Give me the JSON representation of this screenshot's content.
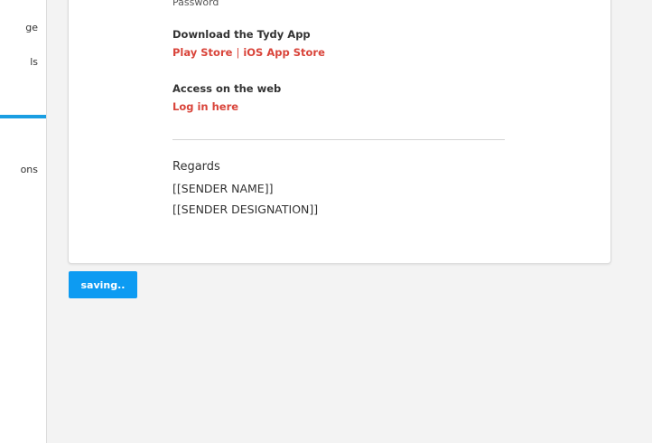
{
  "sidebar": {
    "items": [
      {
        "label": "ge"
      },
      {
        "label": "ls"
      },
      {
        "label": "ons"
      }
    ]
  },
  "email": {
    "cutoff_label": "Password",
    "download_heading": "Download the Tydy App",
    "play_store": "Play Store",
    "link_separator": "|",
    "ios_store": "iOS App Store",
    "web_heading": "Access on the web",
    "login_link": "Log in here",
    "regards": "Regards",
    "sender_name": "[[SENDER NAME]]",
    "sender_designation": "[[SENDER DESIGNATION]]"
  },
  "actions": {
    "save_label": "saving.."
  },
  "colors": {
    "accent": "#0d9bf2",
    "link": "#d9443a",
    "active_nav": "#1a9ee2"
  }
}
